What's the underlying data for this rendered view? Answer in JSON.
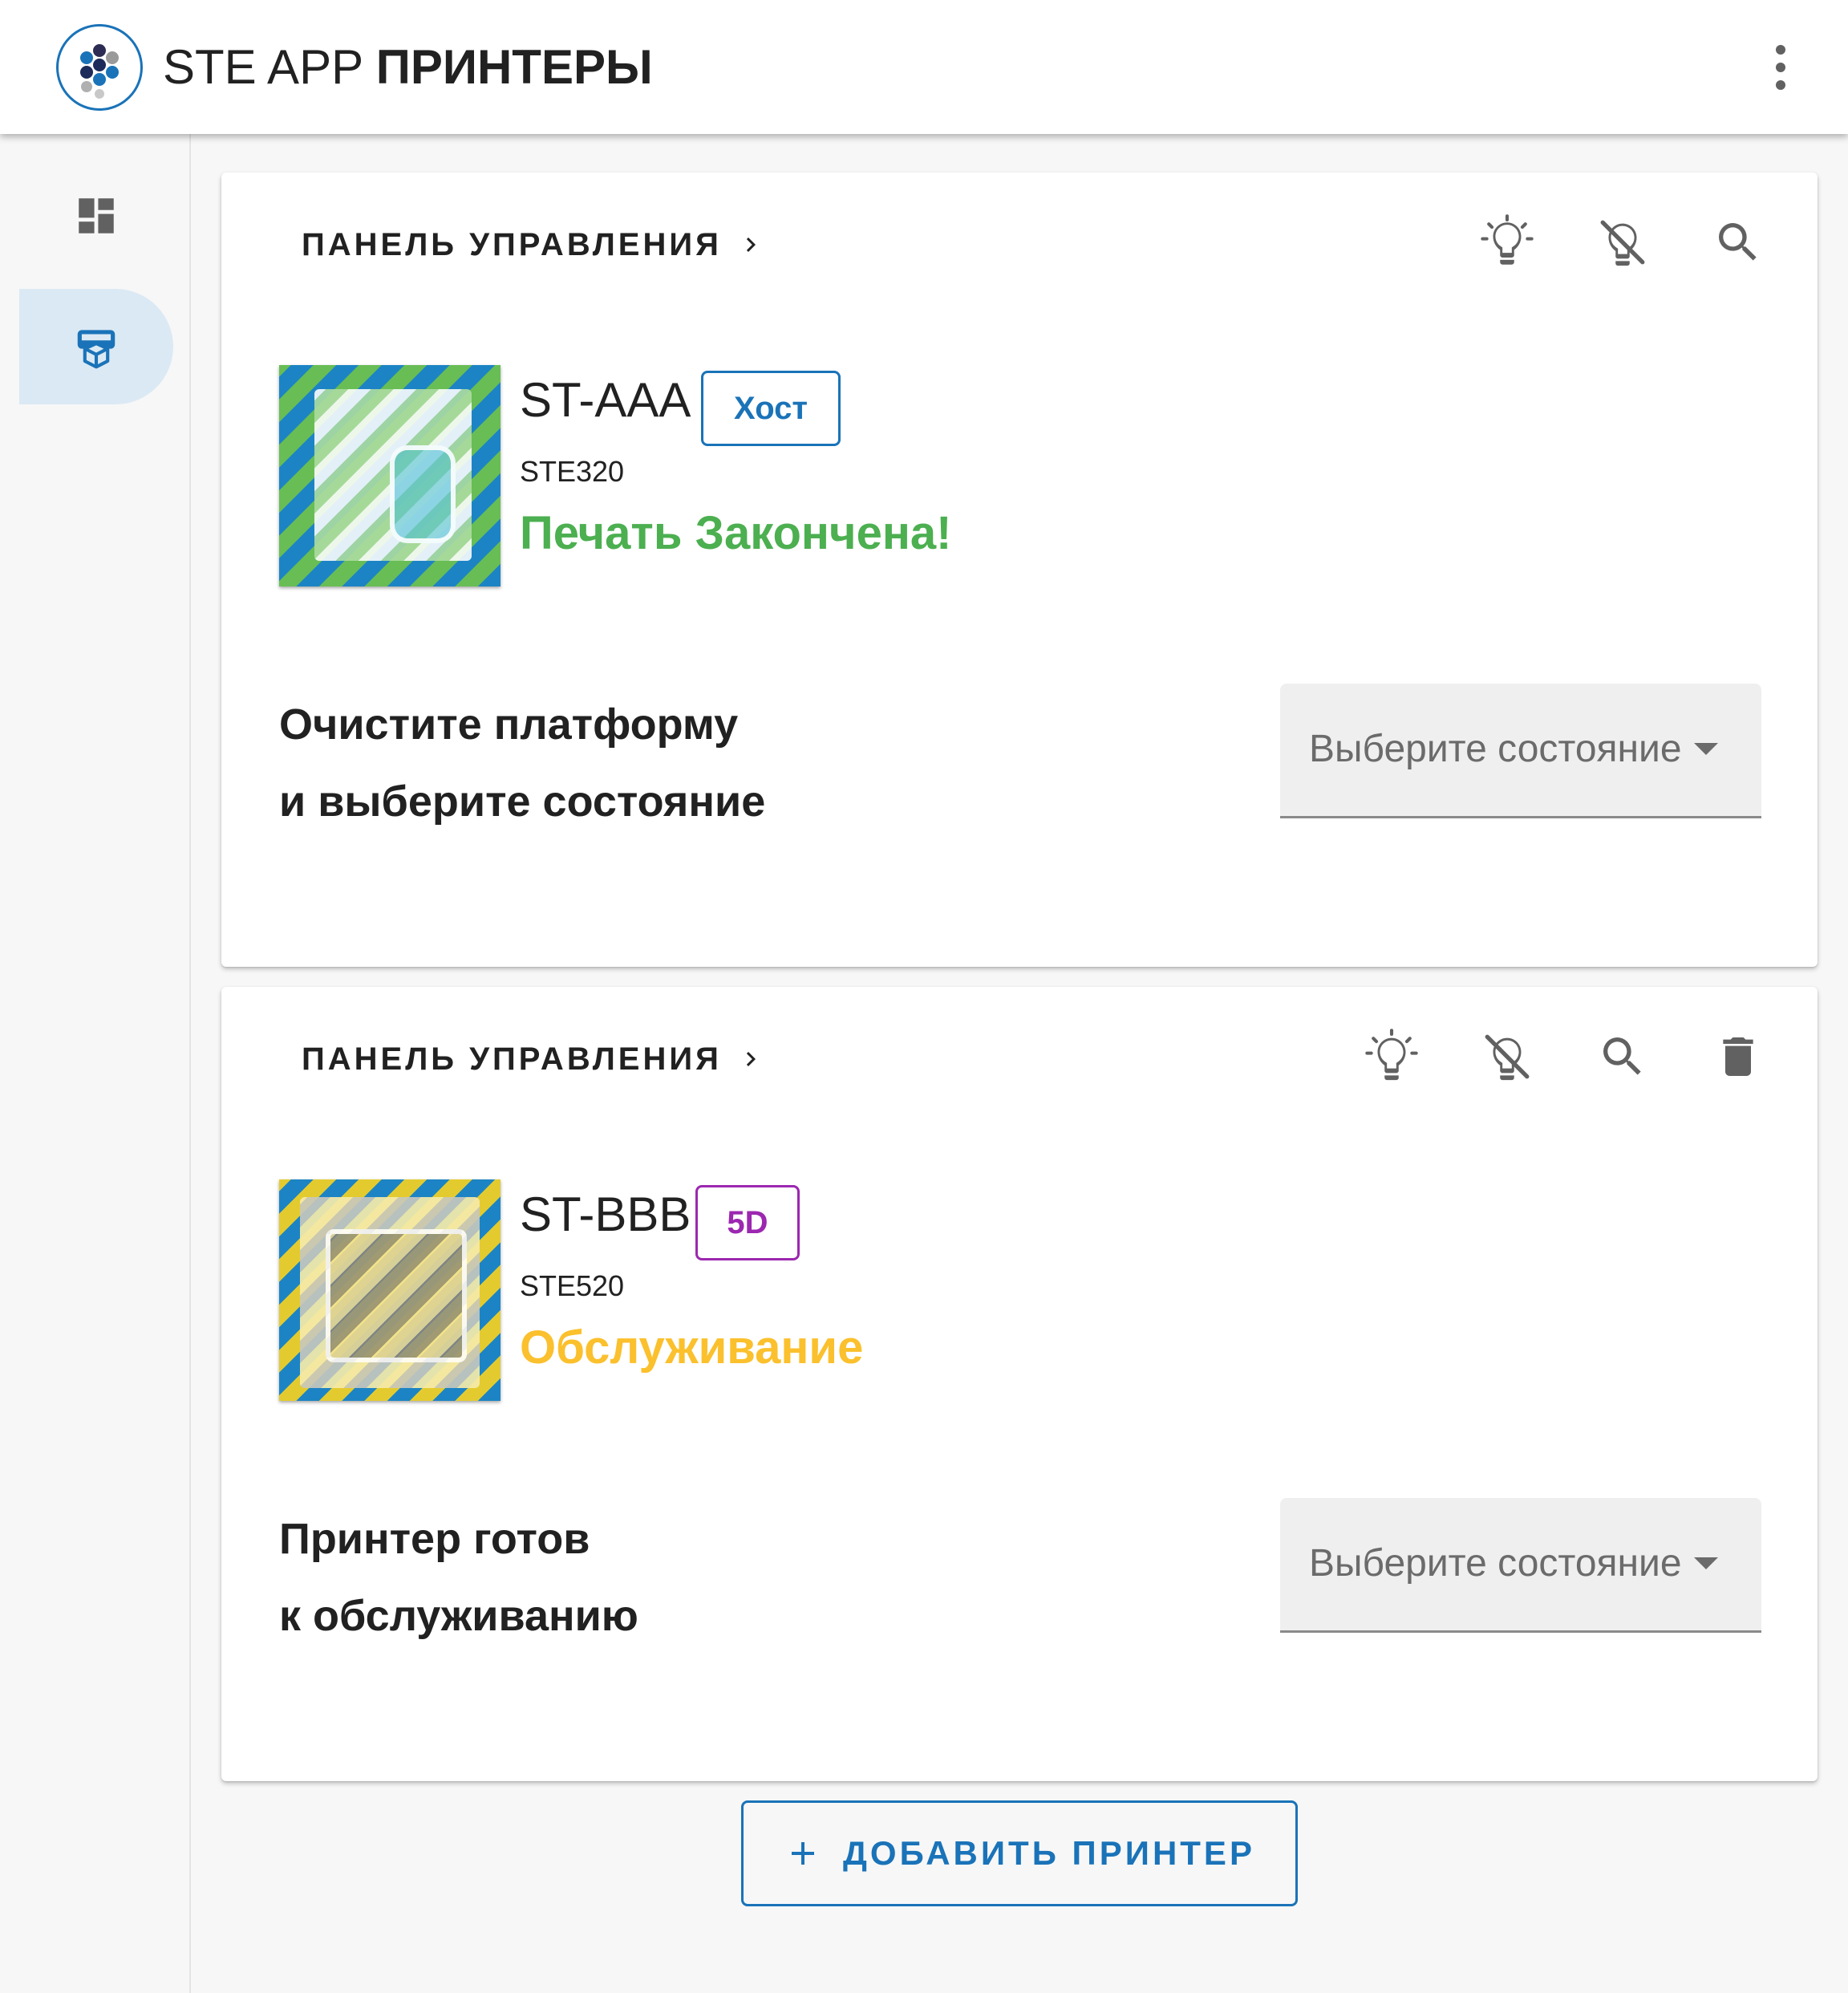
{
  "header": {
    "app_name": "STE APP",
    "page_title": "ПРИНТЕРЫ",
    "icons": {
      "logo": "ste-logo",
      "menu": "more-vert-icon"
    }
  },
  "sidebar": {
    "items": [
      {
        "name": "dashboard",
        "icon": "dashboard-icon",
        "active": false
      },
      {
        "name": "printers",
        "icon": "printer-icon",
        "active": true
      }
    ]
  },
  "printers": [
    {
      "breadcrumb": "ПАНЕЛЬ УПРАВЛЕНИЯ",
      "actions": [
        "light-on-icon",
        "light-off-icon",
        "search-icon"
      ],
      "name": "ST-AAA",
      "tag": "Хост",
      "model": "STE320",
      "status": "Печать Закончена!",
      "status_color": "#4caf50",
      "instruction_line1": "Очистите платформу",
      "instruction_line2": "и выберите состояние",
      "select_placeholder": "Выберите состояние"
    },
    {
      "breadcrumb": "ПАНЕЛЬ УПРАВЛЕНИЯ",
      "actions": [
        "light-on-icon",
        "light-off-icon",
        "search-icon",
        "delete-icon"
      ],
      "name": "ST-BBB",
      "tag": "5D",
      "model": "STE520",
      "status": "Обслуживание",
      "status_color": "#fbc02d",
      "instruction_line1": "Принтер готов",
      "instruction_line2": "к обслуживанию",
      "select_placeholder": "Выберите состояние"
    }
  ],
  "add_button": {
    "label": "ДОБАВИТЬ ПРИНТЕР",
    "icon": "plus-icon"
  },
  "colors": {
    "primary": "#1a73b8",
    "tag_host": "#1a73b8",
    "tag_5d": "#9c27b0",
    "status_done": "#4caf50",
    "status_service": "#fbc02d",
    "rail_active": "#dbe9f4"
  }
}
